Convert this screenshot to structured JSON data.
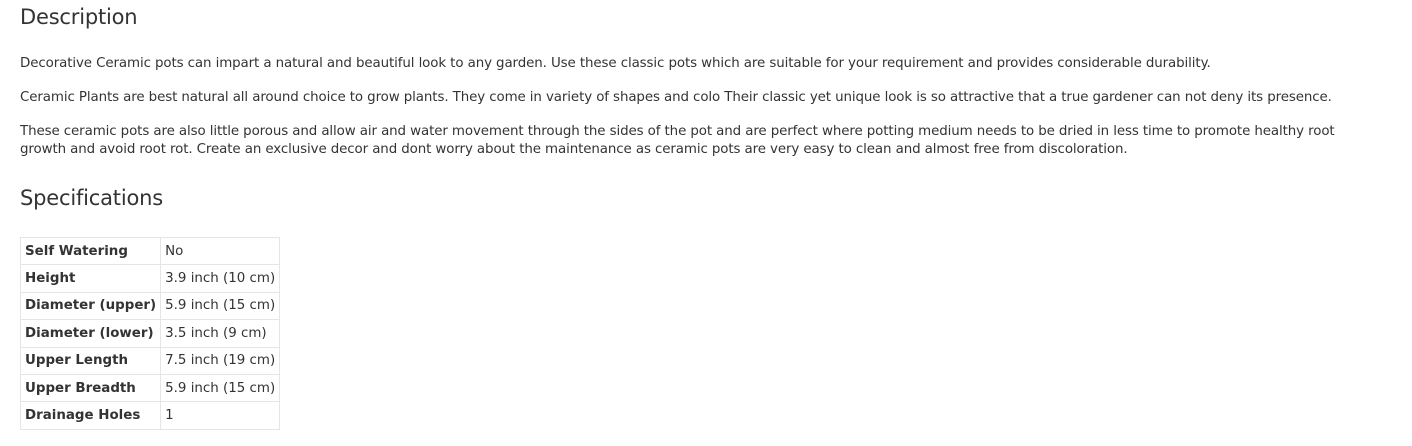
{
  "description": {
    "heading": "Description",
    "paragraphs": [
      "Decorative Ceramic pots can impart a natural and beautiful look to any garden. Use these classic pots which are suitable for your requirement and provides considerable durability.",
      "Ceramic Plants are best natural all around choice to grow plants. They come in variety of shapes and colo Their classic yet unique look is so attractive that a true gardener can not deny its presence.",
      "These ceramic pots are also little porous and allow air and water movement through the sides of the pot and are perfect where potting medium needs to be dried in less time to promote healthy root growth and avoid root rot. Create an exclusive decor and dont worry about the maintenance as ceramic pots are very easy to clean and almost free from discoloration."
    ]
  },
  "specifications": {
    "heading": "Specifications",
    "rows": [
      {
        "label": "Self Watering",
        "value": "No"
      },
      {
        "label": "Height",
        "value": "3.9 inch (10 cm)"
      },
      {
        "label": "Diameter (upper)",
        "value": "5.9 inch (15 cm)"
      },
      {
        "label": "Diameter (lower)",
        "value": "3.5 inch (9 cm)"
      },
      {
        "label": "Upper Length",
        "value": "7.5 inch (19 cm)"
      },
      {
        "label": "Upper Breadth",
        "value": "5.9 inch (15 cm)"
      },
      {
        "label": "Drainage Holes",
        "value": "1"
      }
    ]
  }
}
